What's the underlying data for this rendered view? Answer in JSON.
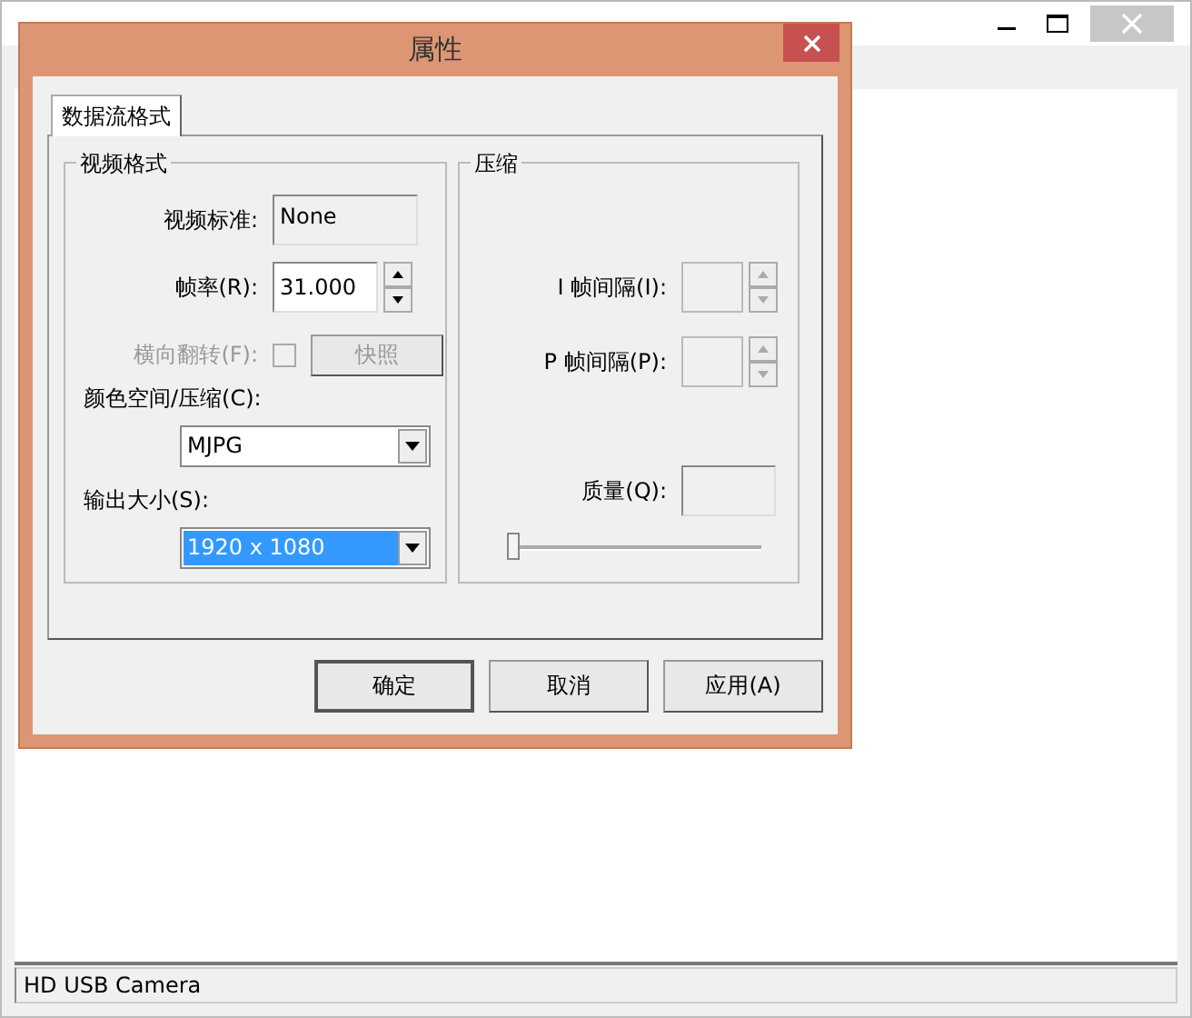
{
  "main_window": {
    "status_bar": "HD USB Camera"
  },
  "dialog": {
    "title": "属性",
    "tabs": [
      {
        "label": "数据流格式",
        "selected": true
      }
    ],
    "video_group": {
      "title": "视频格式",
      "rows": [
        {
          "kind": "readonly",
          "label": "视频标准:",
          "value": "None"
        },
        {
          "kind": "spin",
          "label": "帧率(R):",
          "value": "31.000",
          "disabled": false
        },
        {
          "kind": "checkbox",
          "label": "横向翻转(F):",
          "checked": false,
          "disabled": true,
          "button": "快照"
        },
        {
          "kind": "combo",
          "label": "颜色空间/压缩(C):",
          "value": "MJPG",
          "selected": false
        },
        {
          "kind": "combo",
          "label": "输出大小(S):",
          "value": "1920 x 1080",
          "selected": true
        }
      ]
    },
    "compression_group": {
      "title": "压缩",
      "rows": [
        {
          "kind": "spin",
          "label": "I 帧间隔(I):",
          "disabled": true
        },
        {
          "kind": "spin",
          "label": "P 帧间隔(P):",
          "disabled": true
        },
        {
          "kind": "readonly",
          "label": "质量(Q):"
        }
      ],
      "slider": {
        "level": 0
      }
    },
    "buttons": [
      {
        "label": "确定",
        "default": true
      },
      {
        "label": "取消",
        "default": false
      },
      {
        "label": "应用(A)",
        "default": false
      }
    ]
  }
}
